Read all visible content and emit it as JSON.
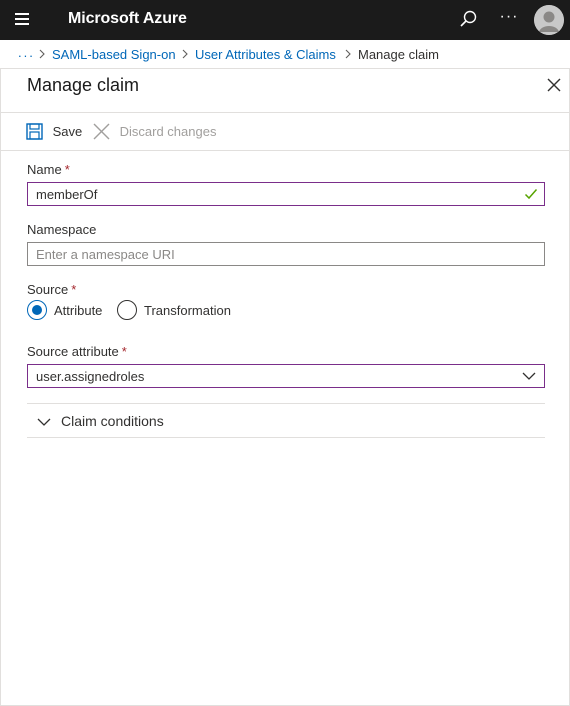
{
  "topbar": {
    "menu_icon": "hamburger-icon",
    "title": "Microsoft Azure",
    "search_icon": "search-icon",
    "more_label": "···",
    "avatar_icon": "user-avatar-icon"
  },
  "breadcrumb": {
    "ellipsis": "...",
    "items": [
      "SAML-based Sign-on",
      "User Attributes & Claims",
      "Manage claim"
    ]
  },
  "blade": {
    "title": "Manage claim",
    "close_icon": "close-icon",
    "commands": {
      "save_label": "Save",
      "save_icon": "save-floppy-icon",
      "discard_label": "Discard changes",
      "discard_icon": "discard-x-icon"
    }
  },
  "form": {
    "name": {
      "label": "Name",
      "required": "*",
      "value": "memberOf",
      "status_icon": "checkmark-icon"
    },
    "namespace": {
      "label": "Namespace",
      "placeholder": "Enter a namespace URI",
      "value": ""
    },
    "source": {
      "label": "Source",
      "required": "*",
      "options": [
        "Attribute",
        "Transformation"
      ],
      "selected": "Attribute"
    },
    "source_attribute": {
      "label": "Source attribute",
      "required": "*",
      "value": "user.assignedroles"
    },
    "claim_conditions": {
      "label": "Claim conditions"
    }
  },
  "colors": {
    "topbar_bg": "#1b1b1b",
    "link": "#0067b8",
    "required": "#a4262c",
    "valid_border": "#7a2e8a",
    "check": "#57a300"
  }
}
